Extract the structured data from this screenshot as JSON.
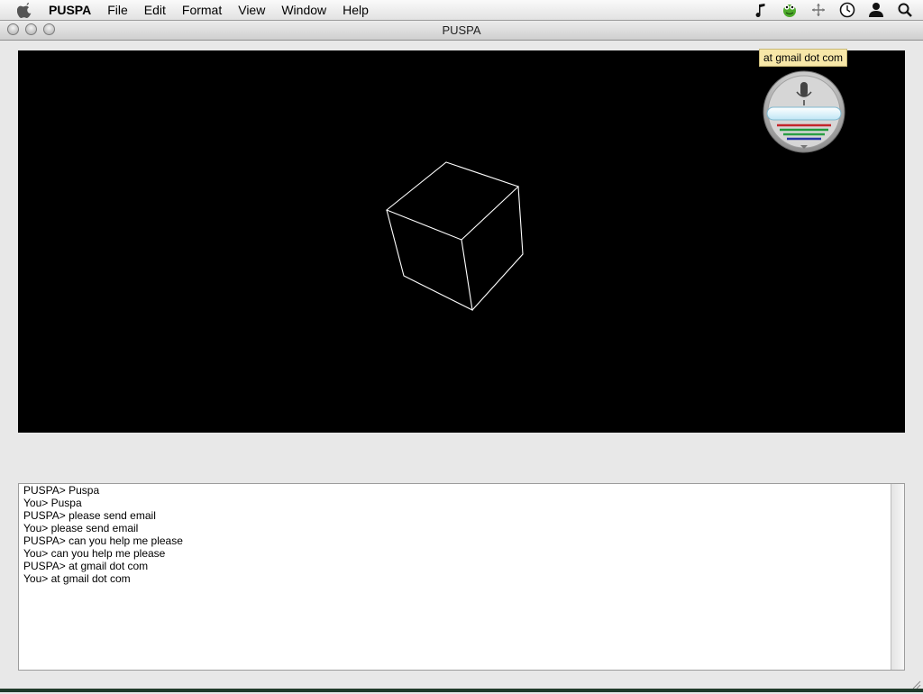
{
  "menubar": {
    "apple_icon": "apple-icon",
    "items": [
      "PUSPA",
      "File",
      "Edit",
      "Format",
      "View",
      "Window",
      "Help"
    ],
    "extras": [
      "music-note-icon",
      "frog-status-icon",
      "network-icon",
      "clock-icon",
      "user-icon",
      "spotlight-search-icon"
    ]
  },
  "window": {
    "title": "PUSPA"
  },
  "speech": {
    "tooltip": "at gmail dot com",
    "widget_icon": "microphone-icon"
  },
  "transcript": {
    "lines": [
      "PUSPA> Puspa",
      "You> Puspa",
      "PUSPA> please send email",
      "You> please send email",
      "PUSPA> can you help me please",
      "You> can you help me please",
      "PUSPA> at gmail dot com",
      "You> at gmail dot com"
    ]
  },
  "colors": {
    "canvas_background": "#000000",
    "wireframe": "#ffffff",
    "tooltip_background": "#f7e7a8"
  }
}
